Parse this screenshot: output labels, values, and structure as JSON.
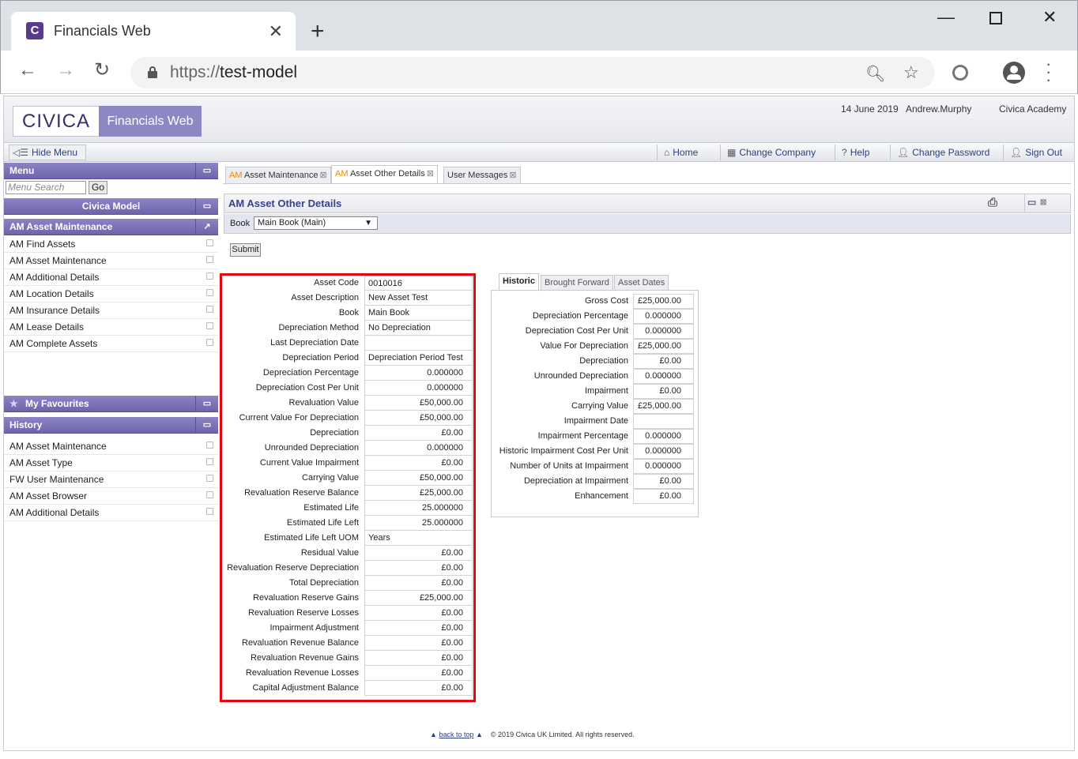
{
  "browser": {
    "tab_title": "Financials Web",
    "url_scheme": "https://",
    "url_host": "test-model"
  },
  "header": {
    "logo": "CIVICA",
    "product": "Financials Web",
    "date": "14 June 2019",
    "user": "Andrew.Murphy",
    "company": "Civica Academy"
  },
  "toolbar": {
    "hide_menu": "Hide Menu",
    "home": "Home",
    "change_company": "Change Company",
    "help": "Help",
    "change_password": "Change Password",
    "sign_out": "Sign Out"
  },
  "sidebar": {
    "menu_title": "Menu",
    "search_placeholder": "Menu Search",
    "go": "Go",
    "model": "Civica Model",
    "section": "AM Asset Maintenance",
    "items": [
      "AM Find Assets",
      "AM Asset Maintenance",
      "AM Additional Details",
      "AM Location Details",
      "AM Insurance Details",
      "AM Lease Details",
      "AM Complete Assets"
    ],
    "favourites": "My Favourites",
    "history": "History",
    "history_items": [
      "AM Asset Maintenance",
      "AM Asset Type",
      "FW User Maintenance",
      "AM Asset Browser",
      "AM Additional Details"
    ]
  },
  "tabs": [
    {
      "prefix": "AM",
      "label": "Asset Maintenance"
    },
    {
      "prefix": "AM",
      "label": "Asset Other Details"
    },
    {
      "prefix": "",
      "label": "User Messages"
    }
  ],
  "panel": {
    "title": "AM Asset Other Details",
    "book_label": "Book",
    "book_value": "Main Book (Main)",
    "submit": "Submit"
  },
  "fields": [
    {
      "label": "Asset Code",
      "value": "0010016",
      "num": false
    },
    {
      "label": "Asset Description",
      "value": "New Asset Test",
      "num": false
    },
    {
      "label": "Book",
      "value": "Main Book",
      "num": false
    },
    {
      "label": "Depreciation Method",
      "value": "No Depreciation",
      "num": false
    },
    {
      "label": "Last Depreciation Date",
      "value": "",
      "num": false
    },
    {
      "label": "Depreciation Period",
      "value": "Depreciation Period Test",
      "num": false
    },
    {
      "label": "Depreciation Percentage",
      "value": "0.000000",
      "num": true
    },
    {
      "label": "Depreciation Cost Per Unit",
      "value": "0.000000",
      "num": true
    },
    {
      "label": "Revaluation Value",
      "value": "£50,000.00",
      "num": true
    },
    {
      "label": "Current Value For Depreciation",
      "value": "£50,000.00",
      "num": true
    },
    {
      "label": "Depreciation",
      "value": "£0.00",
      "num": true
    },
    {
      "label": "Unrounded Depreciation",
      "value": "0.000000",
      "num": true
    },
    {
      "label": "Current Value Impairment",
      "value": "£0.00",
      "num": true
    },
    {
      "label": "Carrying Value",
      "value": "£50,000.00",
      "num": true
    },
    {
      "label": "Revaluation Reserve Balance",
      "value": "£25,000.00",
      "num": true
    },
    {
      "label": "Estimated Life",
      "value": "25.000000",
      "num": true
    },
    {
      "label": "Estimated Life Left",
      "value": "25.000000",
      "num": true
    },
    {
      "label": "Estimated Life Left UOM",
      "value": "Years",
      "num": false
    },
    {
      "label": "Residual Value",
      "value": "£0.00",
      "num": true
    },
    {
      "label": "Revaluation Reserve Depreciation",
      "value": "£0.00",
      "num": true
    },
    {
      "label": "Total Depreciation",
      "value": "£0.00",
      "num": true
    },
    {
      "label": "Revaluation Reserve Gains",
      "value": "£25,000.00",
      "num": true
    },
    {
      "label": "Revaluation Reserve Losses",
      "value": "£0.00",
      "num": true
    },
    {
      "label": "Impairment Adjustment",
      "value": "£0.00",
      "num": true
    },
    {
      "label": "Revaluation Revenue Balance",
      "value": "£0.00",
      "num": true
    },
    {
      "label": "Revaluation Revenue Gains",
      "value": "£0.00",
      "num": true
    },
    {
      "label": "Revaluation Revenue Losses",
      "value": "£0.00",
      "num": true
    },
    {
      "label": "Capital Adjustment Balance",
      "value": "£0.00",
      "num": true
    }
  ],
  "historic_tabs": [
    "Historic",
    "Brought Forward",
    "Asset Dates"
  ],
  "historic": [
    {
      "label": "Gross Cost",
      "value": "£25,000.00"
    },
    {
      "label": "Depreciation Percentage",
      "value": "0.000000"
    },
    {
      "label": "Depreciation Cost Per Unit",
      "value": "0.000000"
    },
    {
      "label": "Value For Depreciation",
      "value": "£25,000.00"
    },
    {
      "label": "Depreciation",
      "value": "£0.00"
    },
    {
      "label": "Unrounded Depreciation",
      "value": "0.000000"
    },
    {
      "label": "Impairment",
      "value": "£0.00"
    },
    {
      "label": "Carrying Value",
      "value": "£25,000.00"
    },
    {
      "label": "Impairment Date",
      "value": ""
    },
    {
      "label": "Impairment Percentage",
      "value": "0.000000"
    },
    {
      "label": "Historic Impairment Cost Per Unit",
      "value": "0.000000"
    },
    {
      "label": "Number of Units at Impairment",
      "value": "0.000000"
    },
    {
      "label": "Depreciation at Impairment",
      "value": "£0.00"
    },
    {
      "label": "Enhancement",
      "value": "£0.00"
    }
  ],
  "footer": {
    "back_to_top": "back to top",
    "copyright": "© 2019 Civica UK Limited. All rights reserved."
  },
  "colors": {
    "accent": "#7b73b8",
    "highlight_border": "#e30613",
    "tab_prefix": "#e68a14"
  }
}
